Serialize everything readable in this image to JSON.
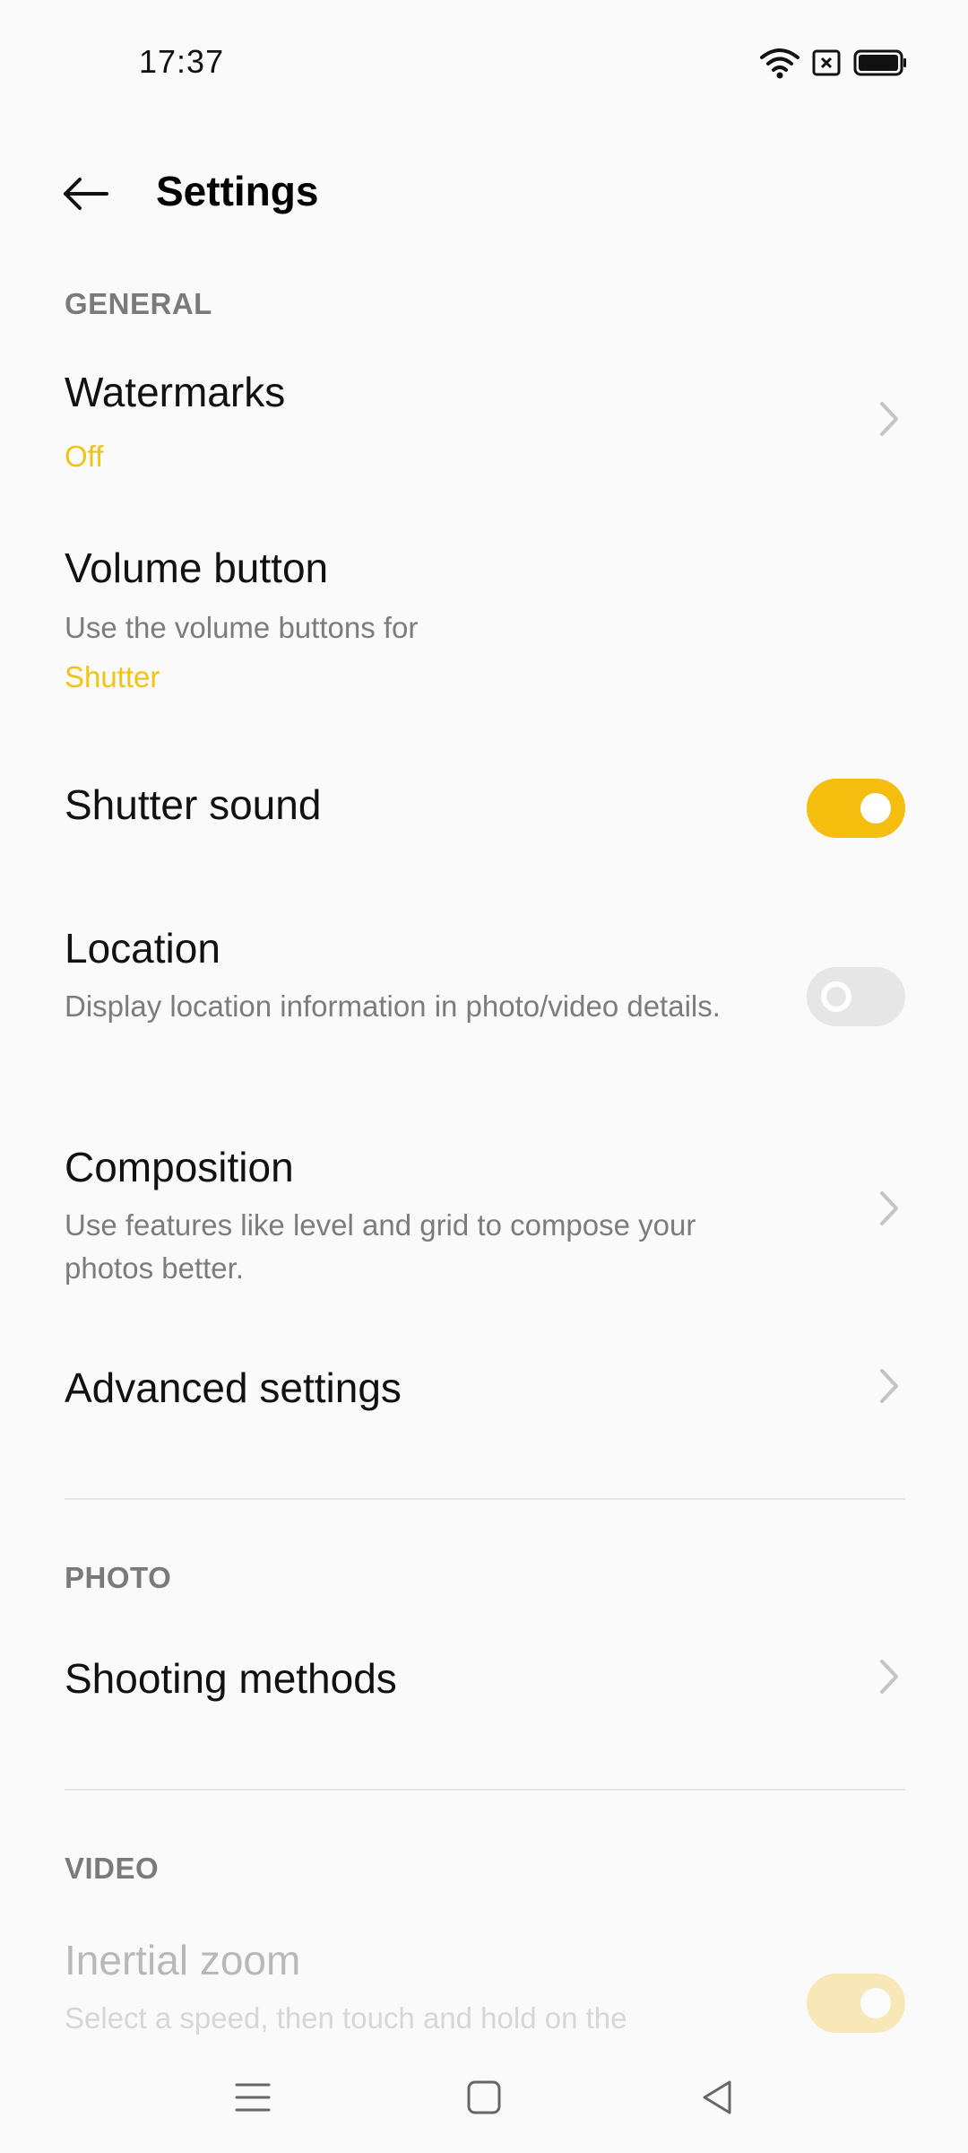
{
  "status_bar": {
    "time": "17:37",
    "icons": [
      "wifi-icon",
      "sim-blocked-icon",
      "battery-icon"
    ]
  },
  "header": {
    "title": "Settings",
    "back_icon": "arrow-left-icon"
  },
  "colors": {
    "accent": "#f5bd0d",
    "accent_text": "#f2c316",
    "secondary_text": "#7c7c7c",
    "section_header": "#7a7a7a"
  },
  "sections": {
    "general": {
      "label": "GENERAL",
      "watermarks": {
        "title": "Watermarks",
        "value": "Off"
      },
      "volume_button": {
        "title": "Volume button",
        "subtitle": "Use the volume buttons for",
        "value": "Shutter"
      },
      "shutter_sound": {
        "title": "Shutter sound",
        "enabled": true
      },
      "location": {
        "title": "Location",
        "subtitle": "Display location information in photo/video details.",
        "enabled": false
      },
      "composition": {
        "title": "Composition",
        "subtitle": "Use features like level and grid to compose your photos better."
      },
      "advanced": {
        "title": "Advanced settings"
      }
    },
    "photo": {
      "label": "PHOTO",
      "shooting_methods": {
        "title": "Shooting methods"
      }
    },
    "video": {
      "label": "VIDEO",
      "inertial_zoom": {
        "title": "Inertial zoom",
        "subtitle": "Select a speed, then touch and hold on the",
        "enabled": true
      }
    }
  },
  "nav_bar": {
    "buttons": [
      "menu-icon",
      "home-icon",
      "back-triangle-icon"
    ]
  }
}
